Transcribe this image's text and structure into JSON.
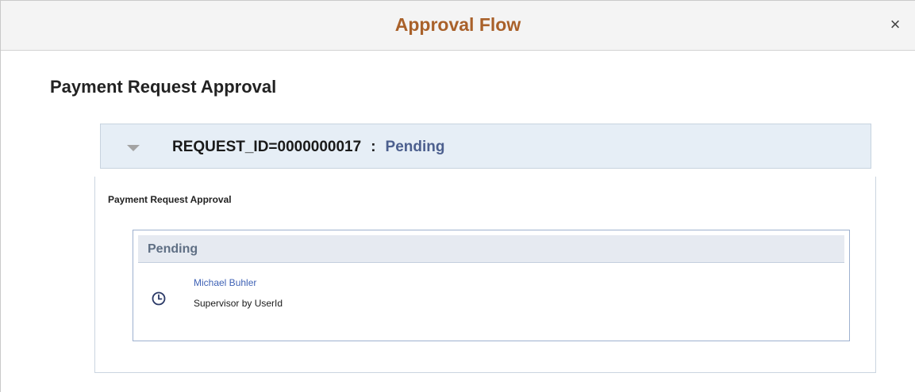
{
  "dialog": {
    "title": "Approval Flow",
    "close_label": "×"
  },
  "page": {
    "title": "Payment Request Approval"
  },
  "request": {
    "id_text": "REQUEST_ID=0000000017",
    "separator": ":",
    "status": "Pending"
  },
  "process": {
    "title": "Payment Request Approval",
    "stage": {
      "status": "Pending",
      "approver_name": "Michael Buhler",
      "approver_role": "Supervisor by UserId",
      "status_icon": "clock-icon"
    }
  },
  "colors": {
    "title_accent": "#a9612a",
    "link": "#3f62b5",
    "status_text": "#4c5f8e",
    "header_bg": "#f4f4f4",
    "request_bar_bg": "#e6eef6"
  }
}
